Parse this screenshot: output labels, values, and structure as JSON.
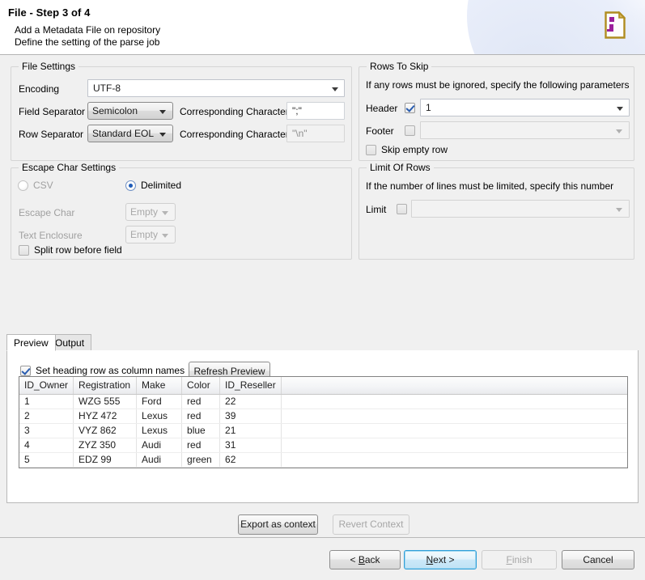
{
  "header": {
    "title_main": "File",
    "title_sep": " - ",
    "title_step": "Step 3 of 4",
    "subtitle_line1": "Add a Metadata File on repository",
    "subtitle_line2": "Define the setting of the parse job",
    "icon": "metadata-file-icon"
  },
  "file_settings": {
    "group_title": "File Settings",
    "encoding_label": "Encoding",
    "encoding_value": "UTF-8",
    "field_separator_label": "Field Separator",
    "field_separator_value": "Semicolon",
    "field_separator_char_label": "Corresponding Character",
    "field_separator_char_value": "\";\"",
    "row_separator_label": "Row Separator",
    "row_separator_value": "Standard EOL",
    "row_separator_char_label": "Corresponding Character",
    "row_separator_char_value": "\"\\n\""
  },
  "escape_settings": {
    "group_title": "Escape Char Settings",
    "csv_label": "CSV",
    "csv_selected": false,
    "delimited_label": "Delimited",
    "delimited_selected": true,
    "escape_char_label": "Escape Char",
    "escape_char_value": "Empty",
    "text_enclosure_label": "Text Enclosure",
    "text_enclosure_value": "Empty",
    "split_row_label": "Split row before field",
    "split_row_checked": false
  },
  "rows_to_skip": {
    "group_title": "Rows To Skip",
    "description": "If any rows must be ignored, specify the following parameters",
    "header_label": "Header",
    "header_checked": true,
    "header_value": "1",
    "footer_label": "Footer",
    "footer_checked": false,
    "footer_value": "",
    "skip_empty_label": "Skip empty row",
    "skip_empty_checked": false
  },
  "limit_of_rows": {
    "group_title": "Limit Of Rows",
    "description": "If the number of lines must be limited, specify this number",
    "limit_label": "Limit",
    "limit_checked": false,
    "limit_value": ""
  },
  "preview_panel": {
    "tabs": [
      {
        "label": "Preview",
        "active": true
      },
      {
        "label": "Output",
        "active": false
      }
    ],
    "heading_row_label": "Set heading row as column names",
    "heading_row_checked": true,
    "refresh_button": "Refresh Preview",
    "export_button": "Export as context",
    "revert_button": "Revert Context",
    "revert_disabled": true
  },
  "table": {
    "columns": [
      "ID_Owner",
      "Registration",
      "Make",
      "Color",
      "ID_Reseller",
      ""
    ],
    "rows": [
      [
        "1",
        "WZG 555",
        "Ford",
        "red",
        "22",
        ""
      ],
      [
        "2",
        "HYZ 472",
        "Lexus",
        "red",
        "39",
        ""
      ],
      [
        "3",
        "VYZ 862",
        "Lexus",
        "blue",
        "21",
        ""
      ],
      [
        "4",
        "ZYZ 350",
        "Audi",
        "red",
        "31",
        ""
      ],
      [
        "5",
        "EDZ 99",
        "Audi",
        "green",
        "62",
        ""
      ]
    ]
  },
  "wizard_buttons": {
    "back": "< Back",
    "next": "Next >",
    "finish": "Finish",
    "cancel": "Cancel",
    "next_focused": true,
    "finish_disabled": true
  },
  "colors": {
    "background": "#f0f0f0",
    "header_background": "#ffffff",
    "focus_blue": "#2f9fd9",
    "radio_blue": "#1e5bb8",
    "icon_gold": "#b08d20",
    "icon_purple": "#9b1f9b"
  }
}
